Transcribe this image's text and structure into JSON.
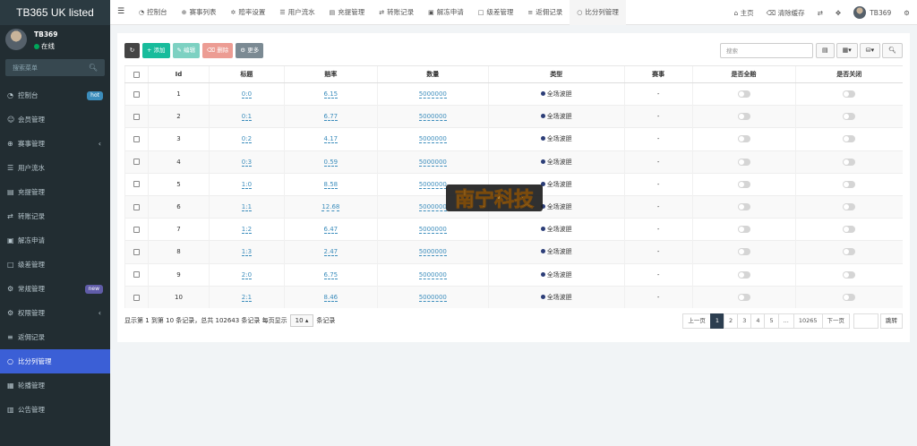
{
  "app": {
    "logo": "TB365 UK listed"
  },
  "user": {
    "name": "TB369",
    "status": "在线"
  },
  "sidebar": {
    "search_placeholder": "搜索菜单",
    "items": [
      {
        "label": "控制台",
        "icon": "dashboard-icon",
        "badge": "hot"
      },
      {
        "label": "会员管理",
        "icon": "users-icon"
      },
      {
        "label": "赛事管理",
        "icon": "event-icon",
        "expandable": true
      },
      {
        "label": "用户流水",
        "icon": "list-icon"
      },
      {
        "label": "充提管理",
        "icon": "wallet-icon"
      },
      {
        "label": "转账记录",
        "icon": "transfer-icon"
      },
      {
        "label": "解冻申请",
        "icon": "unlock-icon"
      },
      {
        "label": "级差管理",
        "icon": "level-icon"
      },
      {
        "label": "常规管理",
        "icon": "settings-icon",
        "badge": "new"
      },
      {
        "label": "权限管理",
        "icon": "permission-icon",
        "expandable": true
      },
      {
        "label": "返佣记录",
        "icon": "rebate-icon"
      },
      {
        "label": "比分列管理",
        "icon": "circle-icon",
        "active": true
      },
      {
        "label": "轮播管理",
        "icon": "carousel-icon"
      },
      {
        "label": "公告管理",
        "icon": "notice-icon"
      }
    ]
  },
  "topbar": {
    "tabs": [
      {
        "label": "控制台",
        "icon": "dashboard-icon"
      },
      {
        "label": "赛事列表",
        "icon": "event-icon"
      },
      {
        "label": "赔率设置",
        "icon": "odds-icon"
      },
      {
        "label": "用户流水",
        "icon": "list-icon"
      },
      {
        "label": "充提管理",
        "icon": "wallet-icon"
      },
      {
        "label": "转账记录",
        "icon": "transfer-icon"
      },
      {
        "label": "解冻申请",
        "icon": "unlock-icon"
      },
      {
        "label": "级差管理",
        "icon": "level-icon"
      },
      {
        "label": "返佣记录",
        "icon": "rebate-icon"
      },
      {
        "label": "比分列管理",
        "icon": "circle-icon",
        "active": true
      }
    ],
    "home": "主页",
    "clear_cache": "清除缓存",
    "username": "TB369"
  },
  "toolbar": {
    "add": "添加",
    "edit": "编辑",
    "delete": "删除",
    "more": "更多",
    "search_placeholder": "搜索"
  },
  "table": {
    "headers": [
      "Id",
      "标题",
      "赔率",
      "数量",
      "类型",
      "赛事",
      "是否全赔",
      "是否关闭"
    ],
    "rows": [
      {
        "id": "1",
        "title": "0:0",
        "odds": "6.15",
        "qty": "5000000",
        "type": "全场波胆",
        "event": "-"
      },
      {
        "id": "2",
        "title": "0:1",
        "odds": "6.77",
        "qty": "5000000",
        "type": "全场波胆",
        "event": "-"
      },
      {
        "id": "3",
        "title": "0:2",
        "odds": "4.17",
        "qty": "5000000",
        "type": "全场波胆",
        "event": "-"
      },
      {
        "id": "4",
        "title": "0:3",
        "odds": "0.59",
        "qty": "5000000",
        "type": "全场波胆",
        "event": "-"
      },
      {
        "id": "5",
        "title": "1:0",
        "odds": "8.58",
        "qty": "5000000",
        "type": "全场波胆",
        "event": "-"
      },
      {
        "id": "6",
        "title": "1:1",
        "odds": "12.68",
        "qty": "5000000",
        "type": "全场波胆",
        "event": "-"
      },
      {
        "id": "7",
        "title": "1:2",
        "odds": "6.47",
        "qty": "5000000",
        "type": "全场波胆",
        "event": "-"
      },
      {
        "id": "8",
        "title": "1:3",
        "odds": "2.47",
        "qty": "5000000",
        "type": "全场波胆",
        "event": "-"
      },
      {
        "id": "9",
        "title": "2:0",
        "odds": "6.75",
        "qty": "5000000",
        "type": "全场波胆",
        "event": "-"
      },
      {
        "id": "10",
        "title": "2:1",
        "odds": "8.46",
        "qty": "5000000",
        "type": "全场波胆",
        "event": "-"
      }
    ]
  },
  "footer": {
    "summary": "显示第 1 到第 10 条记录，总共 102643 条记录 每页显示",
    "page_size": "10",
    "records": "条记录"
  },
  "pagination": {
    "prev": "上一页",
    "pages": [
      "1",
      "2",
      "3",
      "4",
      "5",
      "...",
      "10265"
    ],
    "next": "下一页",
    "jump": "跳转"
  },
  "watermark": {
    "text": "南宁科技"
  },
  "colors": {
    "sidebar": "#222d32",
    "active": "#3b5fd6",
    "add": "#18bc9c",
    "link": "#3c8dbc"
  }
}
